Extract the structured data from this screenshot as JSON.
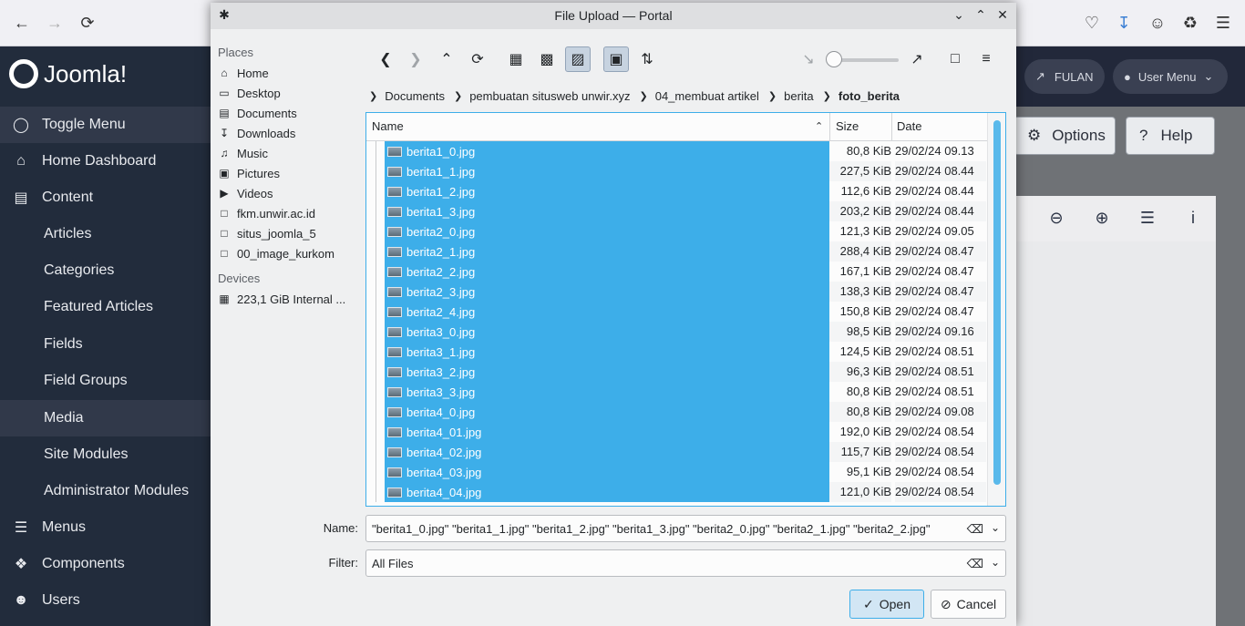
{
  "browser": {
    "back_icon": "arrow-left-icon",
    "forward_icon": "arrow-right-icon",
    "reload_icon": "reload-icon"
  },
  "joomla": {
    "logo_text": "Joomla!",
    "sidebar": [
      {
        "label": "Toggle Menu",
        "icon": "toggle-icon"
      },
      {
        "label": "Home Dashboard",
        "icon": "home-icon"
      },
      {
        "label": "Content",
        "icon": "file-icon"
      },
      {
        "label": "Articles"
      },
      {
        "label": "Categories"
      },
      {
        "label": "Featured Articles"
      },
      {
        "label": "Fields"
      },
      {
        "label": "Field Groups"
      },
      {
        "label": "Media"
      },
      {
        "label": "Site Modules"
      },
      {
        "label": "Administrator Modules"
      },
      {
        "label": "Menus",
        "icon": "list-icon"
      },
      {
        "label": "Components",
        "icon": "puzzle-icon"
      },
      {
        "label": "Users",
        "icon": "users-icon"
      }
    ],
    "header": {
      "site_label": "FULAN",
      "user_menu": "User Menu"
    },
    "toolbar": {
      "options": "Options",
      "help": "Help"
    }
  },
  "dialog": {
    "title": "File Upload — Portal",
    "places_header": "Places",
    "places": [
      {
        "label": "Home",
        "icon": "home-icon"
      },
      {
        "label": "Desktop",
        "icon": "desktop-icon"
      },
      {
        "label": "Documents",
        "icon": "documents-icon"
      },
      {
        "label": "Downloads",
        "icon": "downloads-icon"
      },
      {
        "label": "Music",
        "icon": "music-icon"
      },
      {
        "label": "Pictures",
        "icon": "pictures-icon"
      },
      {
        "label": "Videos",
        "icon": "videos-icon"
      },
      {
        "label": "fkm.unwir.ac.id",
        "icon": "folder-icon"
      },
      {
        "label": "situs_joomla_5",
        "icon": "folder-icon"
      },
      {
        "label": "00_image_kurkom",
        "icon": "folder-icon"
      }
    ],
    "devices_header": "Devices",
    "devices": [
      {
        "label": "223,1 GiB Internal ...",
        "icon": "drive-icon"
      }
    ],
    "breadcrumbs": [
      "Documents",
      "pembuatan situsweb unwir.xyz",
      "04_membuat artikel",
      "berita",
      "foto_berita"
    ],
    "columns": {
      "name": "Name",
      "size": "Size",
      "date": "Date"
    },
    "files": [
      {
        "name": "berita1_0.jpg",
        "size": "80,8 KiB",
        "date": "29/02/24 09.13"
      },
      {
        "name": "berita1_1.jpg",
        "size": "227,5 KiB",
        "date": "29/02/24 08.44"
      },
      {
        "name": "berita1_2.jpg",
        "size": "112,6 KiB",
        "date": "29/02/24 08.44"
      },
      {
        "name": "berita1_3.jpg",
        "size": "203,2 KiB",
        "date": "29/02/24 08.44"
      },
      {
        "name": "berita2_0.jpg",
        "size": "121,3 KiB",
        "date": "29/02/24 09.05"
      },
      {
        "name": "berita2_1.jpg",
        "size": "288,4 KiB",
        "date": "29/02/24 08.47"
      },
      {
        "name": "berita2_2.jpg",
        "size": "167,1 KiB",
        "date": "29/02/24 08.47"
      },
      {
        "name": "berita2_3.jpg",
        "size": "138,3 KiB",
        "date": "29/02/24 08.47"
      },
      {
        "name": "berita2_4.jpg",
        "size": "150,8 KiB",
        "date": "29/02/24 08.47"
      },
      {
        "name": "berita3_0.jpg",
        "size": "98,5 KiB",
        "date": "29/02/24 09.16"
      },
      {
        "name": "berita3_1.jpg",
        "size": "124,5 KiB",
        "date": "29/02/24 08.51"
      },
      {
        "name": "berita3_2.jpg",
        "size": "96,3 KiB",
        "date": "29/02/24 08.51"
      },
      {
        "name": "berita3_3.jpg",
        "size": "80,8 KiB",
        "date": "29/02/24 08.51"
      },
      {
        "name": "berita4_0.jpg",
        "size": "80,8 KiB",
        "date": "29/02/24 09.08"
      },
      {
        "name": "berita4_01.jpg",
        "size": "192,0 KiB",
        "date": "29/02/24 08.54"
      },
      {
        "name": "berita4_02.jpg",
        "size": "115,7 KiB",
        "date": "29/02/24 08.54"
      },
      {
        "name": "berita4_03.jpg",
        "size": "95,1 KiB",
        "date": "29/02/24 08.54"
      },
      {
        "name": "berita4_04.jpg",
        "size": "121,0 KiB",
        "date": "29/02/24 08.54"
      }
    ],
    "name_label": "Name:",
    "name_value": "\"berita1_0.jpg\" \"berita1_1.jpg\" \"berita1_2.jpg\" \"berita1_3.jpg\" \"berita2_0.jpg\" \"berita2_1.jpg\" \"berita2_2.jpg\"",
    "filter_label": "Filter:",
    "filter_value": "All Files",
    "open_label": "Open",
    "cancel_label": "Cancel"
  }
}
